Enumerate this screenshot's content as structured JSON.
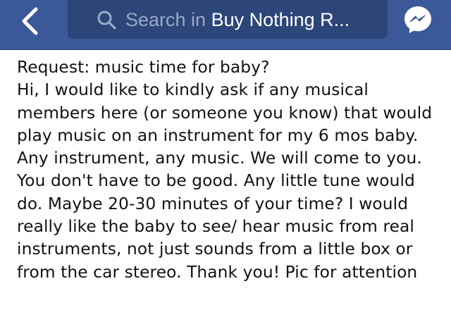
{
  "header": {
    "back_icon": "chevron-left-icon",
    "search_icon": "search-icon",
    "search_prefix": "Search in",
    "search_group": "Buy Nothing R...",
    "messenger_icon": "messenger-icon",
    "colors": {
      "bar": "#3b5998",
      "search_box": "#2d4679",
      "placeholder": "#9aa9c9"
    }
  },
  "post": {
    "title": "Request: music time for baby?",
    "body": "Hi, I would like to kindly ask if any musical members here (or someone you know) that would play music on an instrument for my 6 mos baby. Any instrument, any music. We will come to you. You don't have to be good. Any little tune would do. Maybe 20-30 minutes of your time? I would really like the baby to see/ hear music from real instruments, not just sounds from a little box or from the car stereo. Thank you! Pic for attention"
  }
}
